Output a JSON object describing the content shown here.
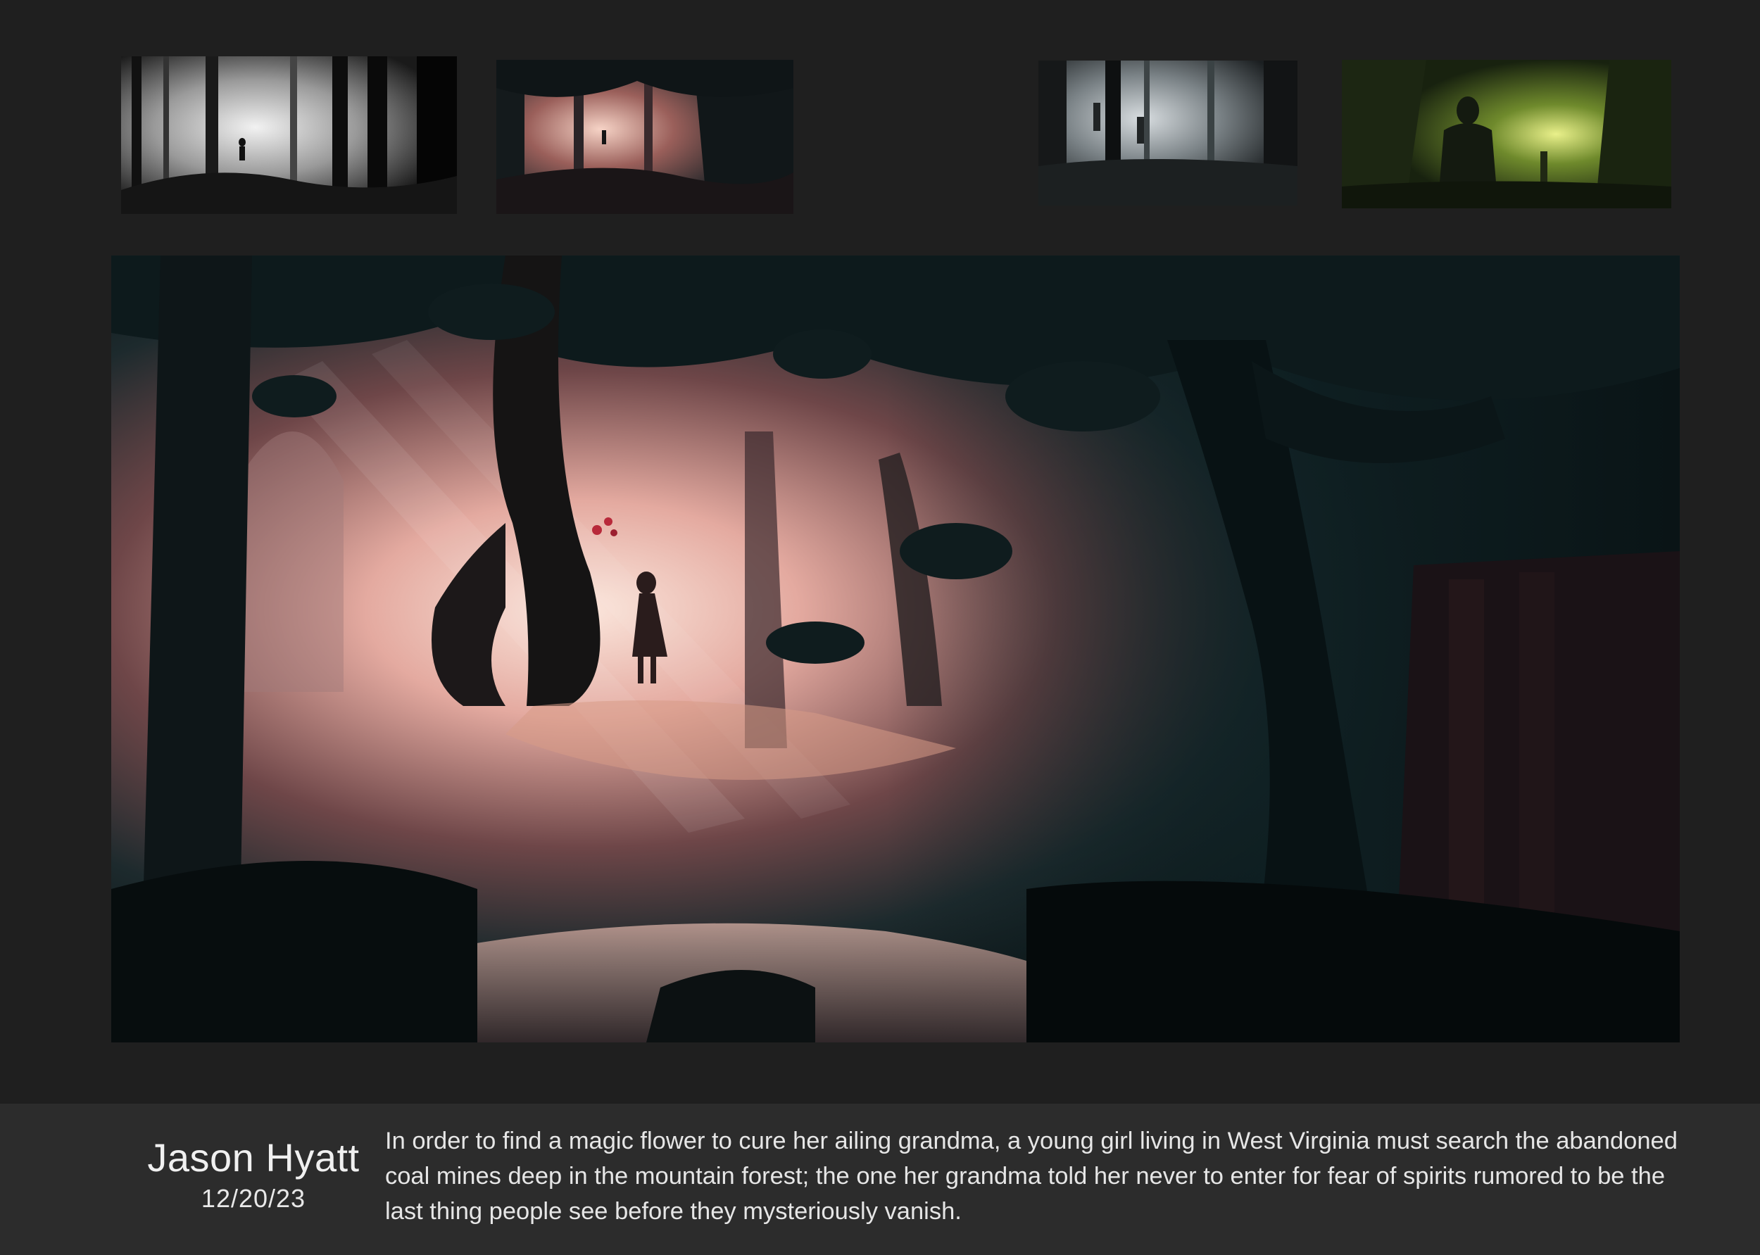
{
  "caption": {
    "artist": "Jason Hyatt",
    "date": "12/20/23",
    "synopsis": "In order to find a magic flower to cure her ailing grandma, a young girl living in West Virginia must search the abandoned coal mines deep in the mountain forest; the one her grandma told her never to enter for fear of spirits rumored to be the last thing people see before they mysteriously vanish."
  },
  "colors": {
    "background": "#1f1f1f",
    "caption_bar": "#2c2c2c",
    "glow_pink": "#f4c8b8",
    "forest_teal": "#0f2a2c",
    "thumb_green": "#9acd32"
  }
}
